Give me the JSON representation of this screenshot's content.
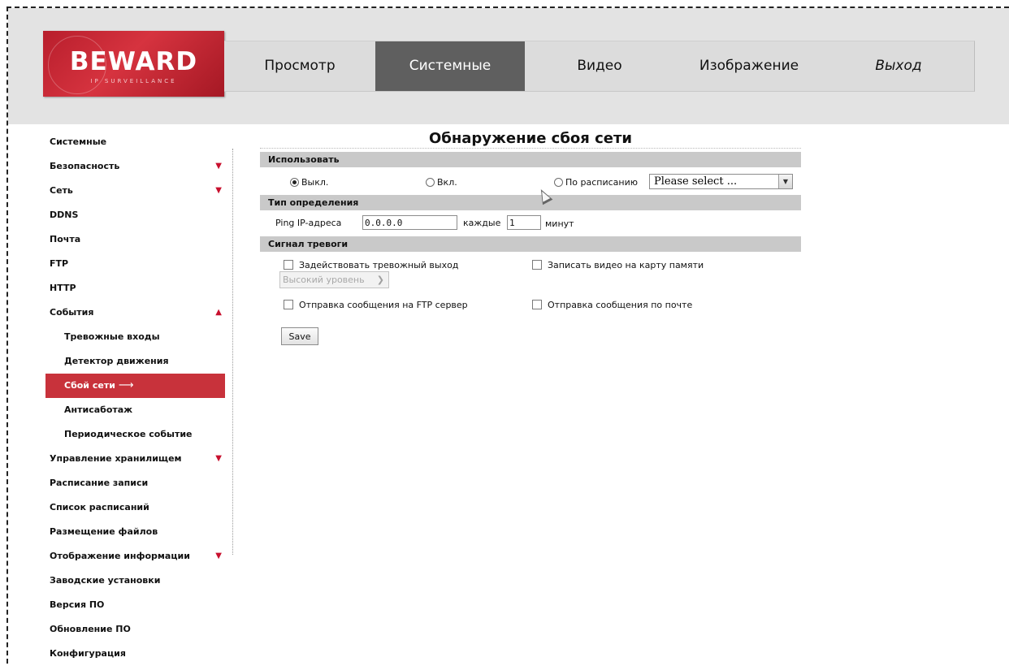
{
  "logo": {
    "brand": "BEWARD",
    "tagline": "IP SURVEILLANCE"
  },
  "topnav": {
    "tabs": [
      {
        "label": "Просмотр",
        "active": false
      },
      {
        "label": "Системные",
        "active": true
      },
      {
        "label": "Видео",
        "active": false
      },
      {
        "label": "Изображение",
        "active": false
      },
      {
        "label": "Выход",
        "active": false
      }
    ]
  },
  "sidebar": {
    "items": [
      {
        "label": "Системные"
      },
      {
        "label": "Безопасность",
        "expand_icon": "triangle-down"
      },
      {
        "label": "Сеть",
        "expand_icon": "triangle-down"
      },
      {
        "label": "DDNS"
      },
      {
        "label": "Почта"
      },
      {
        "label": "FTP"
      },
      {
        "label": "HTTP"
      },
      {
        "label": "События",
        "expand_icon": "triangle-up"
      },
      {
        "label": "Тревожные входы"
      },
      {
        "label": "Детектор движения"
      },
      {
        "label": "Сбой сети",
        "active": true
      },
      {
        "label": "Антисаботаж"
      },
      {
        "label": "Периодическое событие"
      },
      {
        "label": "Управление хранилищем",
        "expand_icon": "triangle-down"
      },
      {
        "label": "Расписание записи"
      },
      {
        "label": "Список расписаний"
      },
      {
        "label": "Размещение файлов"
      },
      {
        "label": "Отображение информации",
        "expand_icon": "triangle-down"
      },
      {
        "label": "Заводские установки"
      },
      {
        "label": "Версия ПО"
      },
      {
        "label": "Обновление ПО"
      },
      {
        "label": "Конфигурация"
      }
    ]
  },
  "page": {
    "title": "Обнаружение сбоя сети",
    "use_section": {
      "heading": "Использовать",
      "options": [
        "Выкл.",
        "Вкл.",
        "По расписанию"
      ],
      "selected": "Выкл.",
      "schedule_select": "Please select ..."
    },
    "detect_section": {
      "heading": "Тип определения",
      "ping_label": "Ping IP-адреса",
      "ping_value": "0.0.0.0",
      "every_label": "каждые",
      "every_value": "1",
      "unit_label": "минут"
    },
    "alarm_section": {
      "heading": "Сигнал тревоги",
      "alarm_output": "Задействовать тревожный выход",
      "level_select": "Высокий уровень",
      "record_sd": "Записать видео на карту памяти",
      "send_ftp": "Отправка сообщения на FTP сервер",
      "send_mail": "Отправка сообщения по почте"
    },
    "save_label": "Save"
  },
  "colors": {
    "accent_red": "#c8323b",
    "header_bg": "#e3e3e3",
    "active_tab": "#5f5f5f",
    "section_bar": "#c9c9c9"
  }
}
